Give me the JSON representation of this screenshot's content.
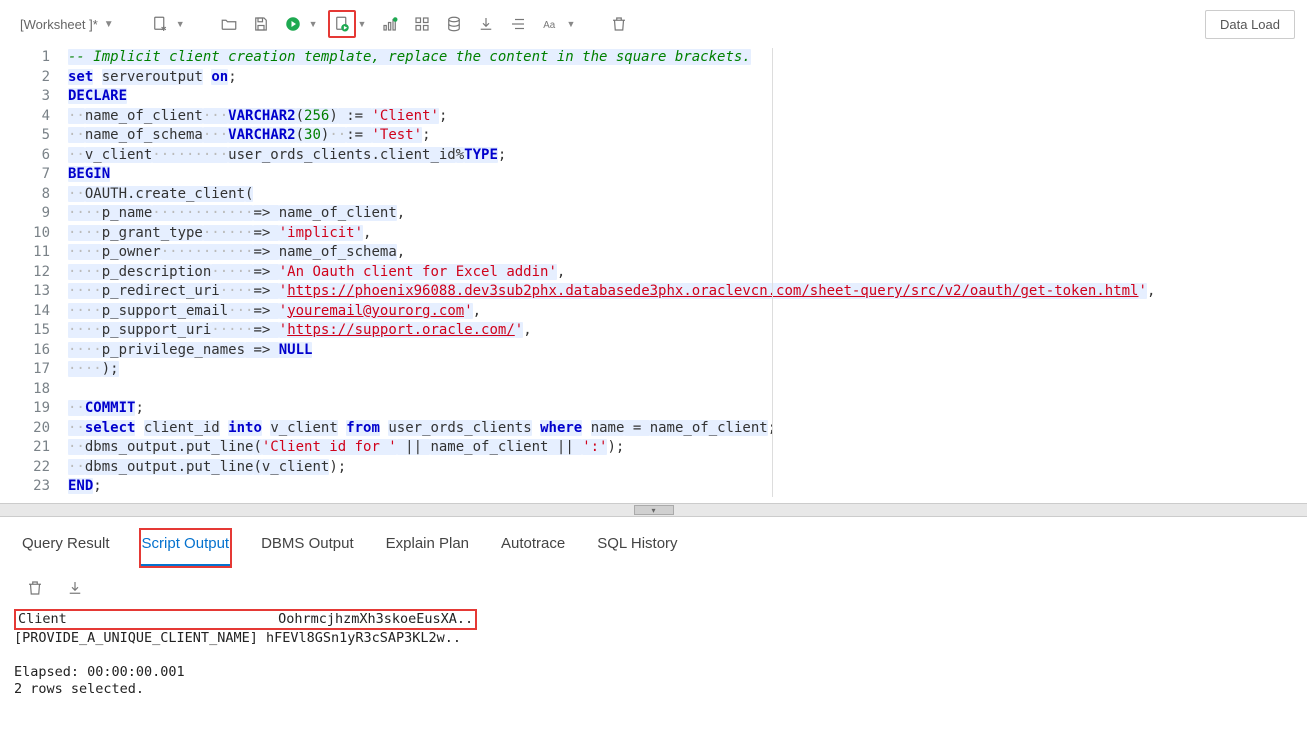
{
  "toolbar": {
    "worksheet_label": "[Worksheet ]*",
    "data_load_label": "Data Load"
  },
  "code": {
    "lines": [
      {
        "n": 1,
        "tokens": [
          {
            "t": "-- Implicit client creation template, replace the content in the square brackets.",
            "c": "cm hl"
          }
        ]
      },
      {
        "n": 2,
        "tokens": [
          {
            "t": "set",
            "c": "kw hl"
          },
          {
            "t": " ",
            "c": ""
          },
          {
            "t": "serveroutput",
            "c": "id hl"
          },
          {
            "t": " ",
            "c": ""
          },
          {
            "t": "on",
            "c": "kw hl"
          },
          {
            "t": ";",
            "c": "op"
          }
        ]
      },
      {
        "n": 3,
        "tokens": [
          {
            "t": "DECLARE",
            "c": "kw hl"
          }
        ]
      },
      {
        "n": 4,
        "tokens": [
          {
            "t": "··",
            "c": "wsdot hl"
          },
          {
            "t": "name_of_client",
            "c": "id hl"
          },
          {
            "t": "···",
            "c": "wsdot hl"
          },
          {
            "t": "VARCHAR2",
            "c": "kw hl"
          },
          {
            "t": "(",
            "c": "op hl"
          },
          {
            "t": "256",
            "c": "num hl"
          },
          {
            "t": ")",
            "c": "op hl"
          },
          {
            "t": " := ",
            "c": "op hl"
          },
          {
            "t": "'Client'",
            "c": "str hl"
          },
          {
            "t": ";",
            "c": "op"
          }
        ]
      },
      {
        "n": 5,
        "tokens": [
          {
            "t": "··",
            "c": "wsdot hl"
          },
          {
            "t": "name_of_schema",
            "c": "id hl"
          },
          {
            "t": "···",
            "c": "wsdot hl"
          },
          {
            "t": "VARCHAR2",
            "c": "kw hl"
          },
          {
            "t": "(",
            "c": "op hl"
          },
          {
            "t": "30",
            "c": "num hl"
          },
          {
            "t": ")",
            "c": "op hl"
          },
          {
            "t": "··",
            "c": "wsdot hl"
          },
          {
            "t": ":= ",
            "c": "op hl"
          },
          {
            "t": "'Test'",
            "c": "str hl"
          },
          {
            "t": ";",
            "c": "op"
          }
        ]
      },
      {
        "n": 6,
        "tokens": [
          {
            "t": "··",
            "c": "wsdot hl"
          },
          {
            "t": "v_client",
            "c": "id hl"
          },
          {
            "t": "·········",
            "c": "wsdot hl"
          },
          {
            "t": "user_ords_clients.client_id",
            "c": "id hl"
          },
          {
            "t": "%",
            "c": "op hl"
          },
          {
            "t": "TYPE",
            "c": "kw hl"
          },
          {
            "t": ";",
            "c": "op"
          }
        ]
      },
      {
        "n": 7,
        "tokens": [
          {
            "t": "BEGIN",
            "c": "kw hl"
          }
        ]
      },
      {
        "n": 8,
        "tokens": [
          {
            "t": "··",
            "c": "wsdot hl"
          },
          {
            "t": "OAUTH.create_client",
            "c": "id hl"
          },
          {
            "t": "(",
            "c": "op hl"
          }
        ]
      },
      {
        "n": 9,
        "tokens": [
          {
            "t": "····",
            "c": "wsdot hl"
          },
          {
            "t": "p_name",
            "c": "id hl"
          },
          {
            "t": "············",
            "c": "wsdot hl"
          },
          {
            "t": "=> ",
            "c": "op hl"
          },
          {
            "t": "name_of_client",
            "c": "id hl"
          },
          {
            "t": ",",
            "c": "op"
          }
        ]
      },
      {
        "n": 10,
        "tokens": [
          {
            "t": "····",
            "c": "wsdot hl"
          },
          {
            "t": "p_grant_type",
            "c": "id hl"
          },
          {
            "t": "······",
            "c": "wsdot hl"
          },
          {
            "t": "=> ",
            "c": "op hl"
          },
          {
            "t": "'implicit'",
            "c": "str hl"
          },
          {
            "t": ",",
            "c": "op"
          }
        ]
      },
      {
        "n": 11,
        "tokens": [
          {
            "t": "····",
            "c": "wsdot hl"
          },
          {
            "t": "p_owner",
            "c": "id hl"
          },
          {
            "t": "···········",
            "c": "wsdot hl"
          },
          {
            "t": "=> ",
            "c": "op hl"
          },
          {
            "t": "name_of_schema",
            "c": "id hl"
          },
          {
            "t": ",",
            "c": "op"
          }
        ]
      },
      {
        "n": 12,
        "tokens": [
          {
            "t": "····",
            "c": "wsdot hl"
          },
          {
            "t": "p_description",
            "c": "id hl"
          },
          {
            "t": "·····",
            "c": "wsdot hl"
          },
          {
            "t": "=> ",
            "c": "op hl"
          },
          {
            "t": "'An Oauth client for Excel addin'",
            "c": "str hl"
          },
          {
            "t": ",",
            "c": "op"
          }
        ]
      },
      {
        "n": 13,
        "tokens": [
          {
            "t": "····",
            "c": "wsdot hl"
          },
          {
            "t": "p_redirect_uri",
            "c": "id hl"
          },
          {
            "t": "····",
            "c": "wsdot hl"
          },
          {
            "t": "=> ",
            "c": "op hl"
          },
          {
            "t": "'",
            "c": "str hl"
          },
          {
            "t": "https://phoenix96088.dev3sub2phx.databasede3phx.oraclevcn.com/sheet-query/src/v2/oauth/get-token.html",
            "c": "lnk hl"
          },
          {
            "t": "'",
            "c": "str hl"
          },
          {
            "t": ",",
            "c": "op"
          }
        ]
      },
      {
        "n": 14,
        "tokens": [
          {
            "t": "····",
            "c": "wsdot hl"
          },
          {
            "t": "p_support_email",
            "c": "id hl"
          },
          {
            "t": "···",
            "c": "wsdot hl"
          },
          {
            "t": "=> ",
            "c": "op hl"
          },
          {
            "t": "'",
            "c": "str hl"
          },
          {
            "t": "youremail@yourorg.com",
            "c": "lnk hl"
          },
          {
            "t": "'",
            "c": "str hl"
          },
          {
            "t": ",",
            "c": "op"
          }
        ]
      },
      {
        "n": 15,
        "tokens": [
          {
            "t": "····",
            "c": "wsdot hl"
          },
          {
            "t": "p_support_uri",
            "c": "id hl"
          },
          {
            "t": "·····",
            "c": "wsdot hl"
          },
          {
            "t": "=> ",
            "c": "op hl"
          },
          {
            "t": "'",
            "c": "str hl"
          },
          {
            "t": "https://support.oracle.com/",
            "c": "lnk hl"
          },
          {
            "t": "'",
            "c": "str hl"
          },
          {
            "t": ",",
            "c": "op"
          }
        ]
      },
      {
        "n": 16,
        "tokens": [
          {
            "t": "····",
            "c": "wsdot hl"
          },
          {
            "t": "p_privilege_names",
            "c": "id hl"
          },
          {
            "t": " => ",
            "c": "op hl"
          },
          {
            "t": "NULL",
            "c": "kw hl"
          }
        ]
      },
      {
        "n": 17,
        "tokens": [
          {
            "t": "····",
            "c": "wsdot hl"
          },
          {
            "t": ");",
            "c": "op hl"
          }
        ]
      },
      {
        "n": 18,
        "tokens": [
          {
            "t": "",
            "c": ""
          }
        ]
      },
      {
        "n": 19,
        "tokens": [
          {
            "t": "··",
            "c": "wsdot hl"
          },
          {
            "t": "COMMIT",
            "c": "kw hl"
          },
          {
            "t": ";",
            "c": "op"
          }
        ]
      },
      {
        "n": 20,
        "tokens": [
          {
            "t": "··",
            "c": "wsdot hl"
          },
          {
            "t": "select",
            "c": "kw hl"
          },
          {
            "t": " ",
            "c": ""
          },
          {
            "t": "client_id",
            "c": "id hl"
          },
          {
            "t": " ",
            "c": ""
          },
          {
            "t": "into",
            "c": "kw hl"
          },
          {
            "t": " ",
            "c": ""
          },
          {
            "t": "v_client",
            "c": "id hl"
          },
          {
            "t": " ",
            "c": ""
          },
          {
            "t": "from",
            "c": "kw hl"
          },
          {
            "t": " ",
            "c": ""
          },
          {
            "t": "user_ords_clients",
            "c": "id hl"
          },
          {
            "t": " ",
            "c": ""
          },
          {
            "t": "where",
            "c": "kw hl"
          },
          {
            "t": " ",
            "c": ""
          },
          {
            "t": "name",
            "c": "id hl"
          },
          {
            "t": " = ",
            "c": "op hl"
          },
          {
            "t": "name_of_client",
            "c": "id hl"
          },
          {
            "t": ";",
            "c": "op"
          }
        ]
      },
      {
        "n": 21,
        "tokens": [
          {
            "t": "··",
            "c": "wsdot hl"
          },
          {
            "t": "dbms_output.put_line",
            "c": "id hl"
          },
          {
            "t": "(",
            "c": "op hl"
          },
          {
            "t": "'Client id for '",
            "c": "str hl"
          },
          {
            "t": " || ",
            "c": "op hl"
          },
          {
            "t": "name_of_client",
            "c": "id hl"
          },
          {
            "t": " || ",
            "c": "op hl"
          },
          {
            "t": "':'",
            "c": "str hl"
          },
          {
            "t": ");",
            "c": "op"
          }
        ]
      },
      {
        "n": 22,
        "tokens": [
          {
            "t": "··",
            "c": "wsdot hl"
          },
          {
            "t": "dbms_output.put_line",
            "c": "id hl"
          },
          {
            "t": "(",
            "c": "op hl"
          },
          {
            "t": "v_client",
            "c": "id hl"
          },
          {
            "t": ");",
            "c": "op"
          }
        ]
      },
      {
        "n": 23,
        "tokens": [
          {
            "t": "END",
            "c": "kw hl"
          },
          {
            "t": ";",
            "c": "op"
          }
        ]
      }
    ]
  },
  "tabs": {
    "items": [
      {
        "label": "Query Result",
        "active": false,
        "highlighted": false
      },
      {
        "label": "Script Output",
        "active": true,
        "highlighted": true
      },
      {
        "label": "DBMS Output",
        "active": false,
        "highlighted": false
      },
      {
        "label": "Explain Plan",
        "active": false,
        "highlighted": false
      },
      {
        "label": "Autotrace",
        "active": false,
        "highlighted": false
      },
      {
        "label": "SQL History",
        "active": false,
        "highlighted": false
      }
    ]
  },
  "output": {
    "row1_col1": "Client",
    "row1_col2": "OohrmcjhzmXh3skoeEusXA..",
    "row2": "[PROVIDE_A_UNIQUE_CLIENT_NAME] hFEVl8GSn1yR3cSAP3KL2w..",
    "elapsed": "Elapsed: 00:00:00.001",
    "rows": "2 rows selected."
  }
}
